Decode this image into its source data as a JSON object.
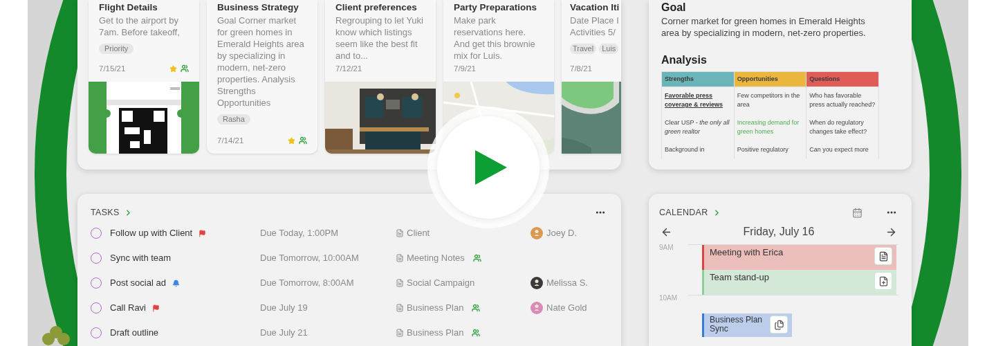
{
  "notes": [
    {
      "title": "Flight Details",
      "body": "Get to the airport by 7am. Before takeoff,",
      "tags": [
        "Priority"
      ],
      "date": "7/15/21",
      "favorite": true,
      "shared": true,
      "image": {
        "kind": "picture"
      }
    },
    {
      "title": "Business Strategy",
      "body": "Goal Corner market for green homes in Emerald Heights area by specializing in modern, net-zero properties. Analysis Strengths Opportunities",
      "tags": [
        "Rasha"
      ],
      "date": "7/14/21",
      "favorite": true,
      "shared": true
    },
    {
      "title": "Client preferences",
      "body": "Regrouping to let Yuki know which listings seem like the best fit and to...",
      "date": "7/12/21",
      "favorite": false,
      "shared": false,
      "image": {
        "kind": "picture"
      }
    },
    {
      "title": "Party Preparations",
      "body": "Make park reservations here. And get this brownie mix for Luis.",
      "date": "7/9/21",
      "favorite": false,
      "shared": false,
      "image": {
        "kind": "picture"
      }
    },
    {
      "title": "Vacation Iti",
      "body": "Date Place I Activities 5/",
      "tags": [
        "Travel",
        "Luis"
      ],
      "date": "7/8/21",
      "favorite": false,
      "shared": false,
      "image": {
        "kind": "picture"
      }
    }
  ],
  "goal": {
    "heading": "Goal",
    "text": "Corner market for green homes in Emerald Heights area by specializing in modern, net-zero properties.",
    "analysis_heading": "Analysis",
    "table": {
      "columns": [
        {
          "label": "Strengths",
          "color": "#6ab5b9"
        },
        {
          "label": "Opportunities",
          "color": "#ebb63e"
        },
        {
          "label": "Questions",
          "color": "#e05c57"
        }
      ],
      "rows": [
        {
          "cells": [
            {
              "text": "Favorable press coverage & reviews",
              "kind": "strong"
            },
            {
              "text": "Few competitors in the area",
              "kind": "plain"
            },
            {
              "text": "Who has favorable press actually reached?",
              "kind": "plain"
            }
          ]
        },
        {
          "cells": [
            {
              "text": "Clear USP - *the only all green realtor*",
              "kind": "plain"
            },
            {
              "text": "Increasing demand for green homes",
              "kind": "positive"
            },
            {
              "text": "When do regulatory changes take effect?",
              "kind": "plain"
            }
          ]
        },
        {
          "cells": [
            {
              "text": "Background in",
              "kind": "plain"
            },
            {
              "text": "Positive regulatory",
              "kind": "plain"
            },
            {
              "text": "Can you expect more",
              "kind": "plain"
            }
          ]
        }
      ]
    }
  },
  "tasks": {
    "title": "TASKS",
    "items": [
      {
        "title": "Follow up with Client",
        "checked": false,
        "kind": "flagged",
        "due": "Due Today, 1:00PM",
        "note": "Client",
        "shared": false,
        "assignee": {
          "name": "Joey D.",
          "color": "#d99a4e"
        }
      },
      {
        "title": "Sync with team",
        "checked": false,
        "kind": "plain",
        "due": "Due Tomorrow, 10:00AM",
        "note": "Meeting Notes",
        "shared": true
      },
      {
        "title": "Post social ad",
        "checked": false,
        "kind": "reminder",
        "due": "Due Tomorrow, 8:00AM",
        "note": "Social Campaign",
        "shared": false,
        "assignee": {
          "name": "Melissa S.",
          "color": "#3a3a3a"
        }
      },
      {
        "title": "Call Ravi",
        "checked": false,
        "kind": "flagged",
        "due": "Due July 19",
        "note": "Business Plan",
        "shared": true,
        "assignee": {
          "name": "Nate Gold",
          "color": "#d98ab8"
        }
      },
      {
        "title": "Draft outline",
        "checked": false,
        "kind": "plain",
        "due": "Due July 21",
        "note": "Business Plan",
        "shared": true
      }
    ]
  },
  "calendar": {
    "title": "CALENDAR",
    "date": "Friday, July 16",
    "slots": [
      {
        "label": "9AM",
        "events": [
          {
            "title": "Meeting with Erica",
            "color": "#d9453f",
            "kind": "note"
          },
          {
            "title": "Team stand-up",
            "color": "#8ccf98",
            "kind": "add-note"
          }
        ]
      },
      {
        "label": "10AM",
        "events": [
          {
            "title": "Business Plan Sync",
            "color": "#3a78d6",
            "kind": "notes"
          }
        ]
      }
    ]
  }
}
